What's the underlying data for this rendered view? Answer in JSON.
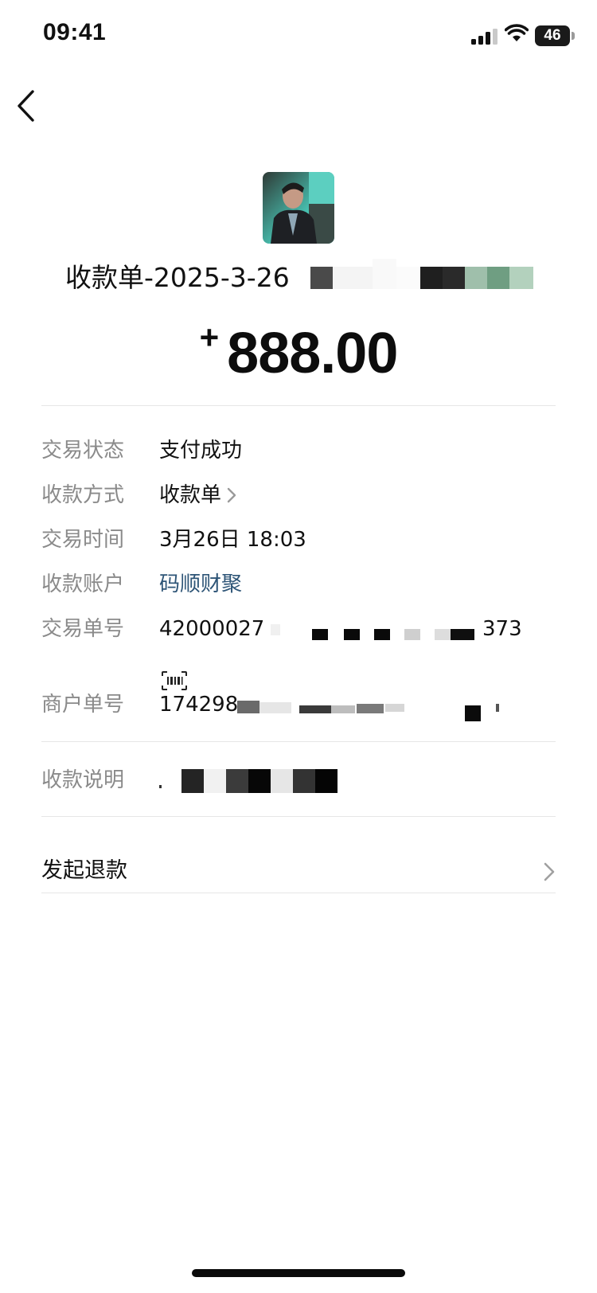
{
  "status_bar": {
    "time": "09:41",
    "battery": "46"
  },
  "header": {
    "payee_title": "收款单-2025-3-26",
    "amount_sign": "+",
    "amount": "888.00"
  },
  "details": {
    "status_label": "交易状态",
    "status_value": "支付成功",
    "method_label": "收款方式",
    "method_value": "收款单",
    "time_label": "交易时间",
    "time_value": "3月26日 18:03",
    "account_label": "收款账户",
    "account_value": "码顺财聚",
    "txn_label": "交易单号",
    "txn_prefix": "42000027",
    "txn_suffix": "373",
    "merchant_label": "商户单号",
    "merchant_prefix": "174298",
    "note_label": "收款说明"
  },
  "actions": {
    "refund_label": "发起退款"
  },
  "icons": {
    "back": "chevron-left-icon",
    "method_chevron": "chevron-right-icon",
    "barcode": "barcode-icon",
    "refund_chevron": "chevron-right-icon"
  },
  "colors": {
    "label_gray": "#8a8a8a",
    "link_blue": "#2e5577",
    "divider": "#e6e6e6"
  }
}
